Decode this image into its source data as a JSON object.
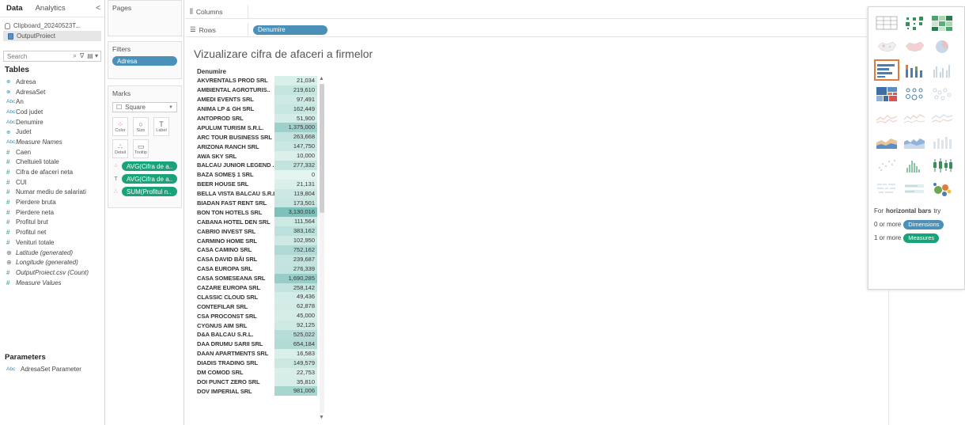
{
  "left_pane": {
    "tab_data": "Data",
    "tab_analytics": "Analytics",
    "collapse": "<",
    "datasources": [
      "Clipboard_20240523T...",
      "OutputProiect"
    ],
    "search_placeholder": "Search",
    "tables_title": "Tables",
    "fields": [
      {
        "icon": "⊕",
        "type": "geo",
        "name": "Adresa",
        "italic": false
      },
      {
        "icon": "⊗",
        "type": "set",
        "name": "AdresaSet",
        "italic": false
      },
      {
        "icon": "Abc",
        "type": "dim",
        "name": "An",
        "italic": false
      },
      {
        "icon": "Abc",
        "type": "dim",
        "name": "Cod judet",
        "italic": false
      },
      {
        "icon": "Abc",
        "type": "dim",
        "name": "Denumire",
        "italic": false
      },
      {
        "icon": "⊕",
        "type": "geo",
        "name": "Judet",
        "italic": false
      },
      {
        "icon": "Abc",
        "type": "dim",
        "name": "Measure Names",
        "italic": true
      },
      {
        "icon": "#",
        "type": "measure",
        "name": "Caen",
        "italic": false
      },
      {
        "icon": "#",
        "type": "measure",
        "name": "Cheltuieli totale",
        "italic": false
      },
      {
        "icon": "#",
        "type": "measure",
        "name": "Cifra de afaceri neta",
        "italic": false
      },
      {
        "icon": "#",
        "type": "measure",
        "name": "CUI",
        "italic": false
      },
      {
        "icon": "#",
        "type": "measure",
        "name": "Numar mediu de salariati",
        "italic": false
      },
      {
        "icon": "#",
        "type": "measure",
        "name": "Pierdere bruta",
        "italic": false
      },
      {
        "icon": "#",
        "type": "measure",
        "name": "Pierdere neta",
        "italic": false
      },
      {
        "icon": "#",
        "type": "measure",
        "name": "Profitul brut",
        "italic": false
      },
      {
        "icon": "#",
        "type": "measure",
        "name": "Profitul net",
        "italic": false
      },
      {
        "icon": "#",
        "type": "measure",
        "name": "Venituri totale",
        "italic": false
      },
      {
        "icon": "⊕",
        "type": "geo-measure",
        "name": "Latitude (generated)",
        "italic": true
      },
      {
        "icon": "⊕",
        "type": "geo-measure",
        "name": "Longitude (generated)",
        "italic": true
      },
      {
        "icon": "#",
        "type": "measure",
        "name": "OutputProiect.csv (Count)",
        "italic": true
      },
      {
        "icon": "#",
        "type": "measure",
        "name": "Measure Values",
        "italic": true
      }
    ],
    "parameters_title": "Parameters",
    "parameter": {
      "icon": "Abc",
      "name": "AdresaSet Parameter"
    }
  },
  "shelves": {
    "pages_title": "Pages",
    "filters_title": "Filters",
    "filter_pill": "Adresa",
    "marks_title": "Marks",
    "mark_type": "Square",
    "mark_buttons": [
      "Color",
      "Size",
      "Label",
      "Detail",
      "Tooltip"
    ],
    "marks_pills": [
      "AVG(Cifra de a..",
      "AVG(Cifra de a..",
      "SUM(Profitul n.."
    ],
    "columns_label": "Columns",
    "rows_label": "Rows",
    "rows_pill": "Denumire"
  },
  "viz": {
    "title": "Vizualizare cifra de afaceri a firmelor",
    "column_header": "Denumire",
    "rows": [
      {
        "name": "AKVRENTALS PROD SRL",
        "value": "21,034",
        "v": 21034
      },
      {
        "name": "AMBIENTAL AGROTURIS..",
        "value": "219,610",
        "v": 219610
      },
      {
        "name": "AMEDI EVENTS SRL",
        "value": "97,491",
        "v": 97491
      },
      {
        "name": "ANIMA LP & GH SRL",
        "value": "162,449",
        "v": 162449
      },
      {
        "name": "ANTOPROD SRL",
        "value": "51,900",
        "v": 51900
      },
      {
        "name": "APULUM TURISM S.R.L.",
        "value": "1,375,000",
        "v": 1375000
      },
      {
        "name": "ARC TOUR BUSINESS SRL",
        "value": "263,668",
        "v": 263668
      },
      {
        "name": "ARIZONA RANCH SRL",
        "value": "147,750",
        "v": 147750
      },
      {
        "name": "AWA SKY SRL",
        "value": "10,000",
        "v": 10000
      },
      {
        "name": "BALCAU JUNIOR LEGEND ..",
        "value": "277,332",
        "v": 277332
      },
      {
        "name": "BAZA SOMEȘ 1 SRL",
        "value": "0",
        "v": 0
      },
      {
        "name": "BEER HOUSE SRL",
        "value": "21,131",
        "v": 21131
      },
      {
        "name": "BELLA VISTA BALCAU S.R.L.",
        "value": "119,804",
        "v": 119804
      },
      {
        "name": "BIADAN FAST RENT SRL",
        "value": "173,501",
        "v": 173501
      },
      {
        "name": "BON TON HOTELS SRL",
        "value": "3,130,016",
        "v": 3130016
      },
      {
        "name": "CABANA HOTEL DEN SRL",
        "value": "111,564",
        "v": 111564
      },
      {
        "name": "CABRIO INVEST SRL",
        "value": "383,162",
        "v": 383162
      },
      {
        "name": "CARMINO HOME SRL",
        "value": "102,950",
        "v": 102950
      },
      {
        "name": "CASA CAMINO SRL",
        "value": "752,162",
        "v": 752162
      },
      {
        "name": "CASA DAVID BĂI SRL",
        "value": "239,687",
        "v": 239687
      },
      {
        "name": "CASA EUROPA SRL",
        "value": "276,339",
        "v": 276339
      },
      {
        "name": "CASA SOMESEANA SRL",
        "value": "1,690,285",
        "v": 1690285
      },
      {
        "name": "CAZARE EUROPA SRL",
        "value": "258,142",
        "v": 258142
      },
      {
        "name": "CLASSIC CLOUD SRL",
        "value": "49,436",
        "v": 49436
      },
      {
        "name": "CONTEFILAR SRL",
        "value": "62,878",
        "v": 62878
      },
      {
        "name": "CSA PROCONST SRL",
        "value": "45,000",
        "v": 45000
      },
      {
        "name": "CYGNUS AIM SRL",
        "value": "92,125",
        "v": 92125
      },
      {
        "name": "D&A BALCAU S.R.L.",
        "value": "525,022",
        "v": 525022
      },
      {
        "name": "DAA DRUMU SARII SRL",
        "value": "654,184",
        "v": 654184
      },
      {
        "name": "DAAN APARTMENTS SRL",
        "value": "16,583",
        "v": 16583
      },
      {
        "name": "DIADIS TRADING SRL",
        "value": "149,579",
        "v": 149579
      },
      {
        "name": "DM COMOD SRL",
        "value": "22,753",
        "v": 22753
      },
      {
        "name": "DOI PUNCT ZERO SRL",
        "value": "35,810",
        "v": 35810
      },
      {
        "name": "DOV IMPERIAL SRL",
        "value": "981,006",
        "v": 981006
      }
    ]
  },
  "showme": {
    "hint_prefix": "For",
    "hint_bold": "horizontal bars",
    "hint_suffix": "try",
    "req1_prefix": "0 or more",
    "req1_pill": "Dimensions",
    "req2_prefix": "1 or more",
    "req2_pill": "Measures",
    "selected_index": 6
  },
  "colors": {
    "accent_blue": "#4a90b8",
    "accent_green": "#1aa37a",
    "heat_low": "#e4f4ef",
    "heat_high": "#7ec1bb",
    "selected_border": "#e07b39"
  }
}
